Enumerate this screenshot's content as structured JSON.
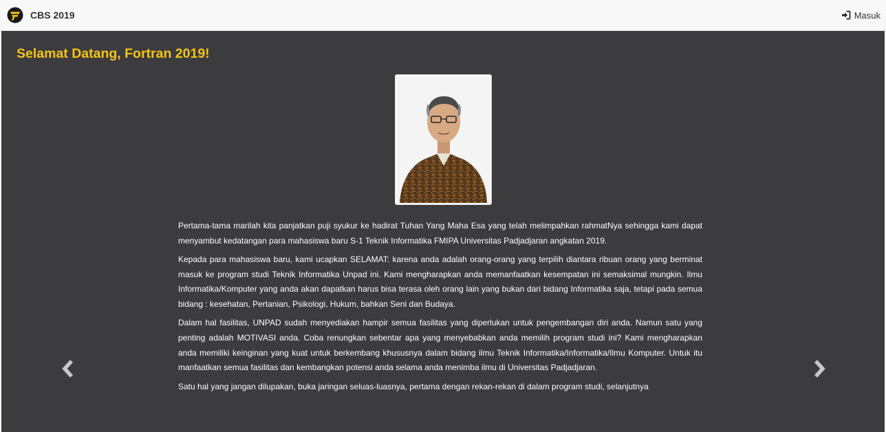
{
  "navbar": {
    "brand_text": "CBS 2019",
    "logo_icon": "brand-logo-icon",
    "login_label": "Masuk",
    "login_icon": "sign-in-icon"
  },
  "main": {
    "welcome_title": "Selamat Datang, Fortran 2019!",
    "photo_alt": "portrait",
    "paragraphs": [
      "Pertama-tama marilah kita panjatkan puji syukur ke hadirat Tuhan Yang Maha Esa yang telah melimpahkan rahmatNya sehingga kami dapat menyambut kedatangan para mahasiswa baru S-1 Teknik Informatika FMIPA Universitas Padjadjaran angkatan 2019.",
      "Kepada para mahasiswa baru, kami ucapkan SELAMAT: karena anda adalah orang-orang yang terpilih diantara ribuan orang yang berminat masuk ke program studi Teknik Informatika Unpad ini. Kami mengharapkan anda memanfaatkan kesempatan ini semaksimal mungkin. Ilmu Informatika/Komputer yang anda akan dapatkan harus bisa terasa oleh orang lain yang bukan dari bidang Informatika saja, tetapi pada semua bidang : kesehatan, Pertanian, Psikologi, Hukum, bahkan Seni dan Budaya.",
      "Dalam hal fasilitas, UNPAD sudah menyediakan hampir semua fasilitas yang diperlukan untuk pengembangan diri anda. Namun satu yang penting adalah MOTIVASI anda. Coba renungkan sebentar apa yang menyebabkan anda memilih program studi ini? Kami mengharapkan anda memiliki keinginan yang kuat untuk berkembang khususnya dalam bidang ilmu Teknik Informatika/Informatika/Ilmu Komputer. Untuk itu manfaatkan semua fasilitas dan kembangkan potensi anda selama anda menimba ilmu di Universitas Padjadjaran.",
      "Satu hal yang jangan dilupakan, buka jaringan seluas-luasnya, pertama dengan rekan-rekan di dalam program studi, selanjutnya"
    ]
  },
  "carousel": {
    "prev_icon": "chevron-left-icon",
    "next_icon": "chevron-right-icon"
  },
  "colors": {
    "accent": "#f5c518",
    "background": "#3c3b3e",
    "navbar": "#f8f8f8",
    "text": "#ffffff"
  }
}
